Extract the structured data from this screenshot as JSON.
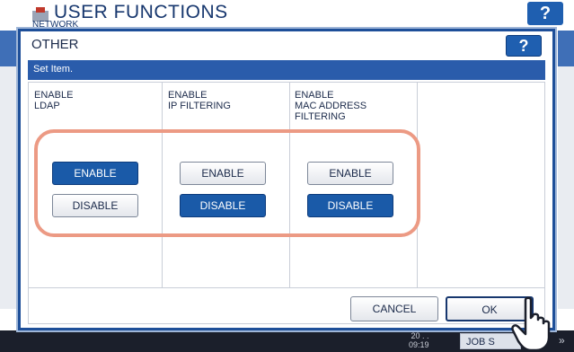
{
  "background": {
    "title": "USER FUNCTIONS",
    "subtitle": "NETWORK",
    "help_label": "?",
    "time": "09:19",
    "date_partial": "20 . . ",
    "job_label": "JOB S",
    "arrow": "»"
  },
  "dialog": {
    "title": "OTHER",
    "help_label": "?",
    "bar_text": "Set Item.",
    "columns": [
      {
        "label": "ENABLE\nLDAP",
        "enable_label": "ENABLE",
        "disable_label": "DISABLE",
        "selected": "ENABLE"
      },
      {
        "label": "ENABLE\nIP FILTERING",
        "enable_label": "ENABLE",
        "disable_label": "DISABLE",
        "selected": "DISABLE"
      },
      {
        "label": "ENABLE\nMAC ADDRESS\nFILTERING",
        "enable_label": "ENABLE",
        "disable_label": "DISABLE",
        "selected": "DISABLE"
      }
    ],
    "cancel_label": "CANCEL",
    "ok_label": "OK"
  },
  "colors": {
    "accent": "#1a5aa8",
    "highlight": "#ec9a84"
  }
}
